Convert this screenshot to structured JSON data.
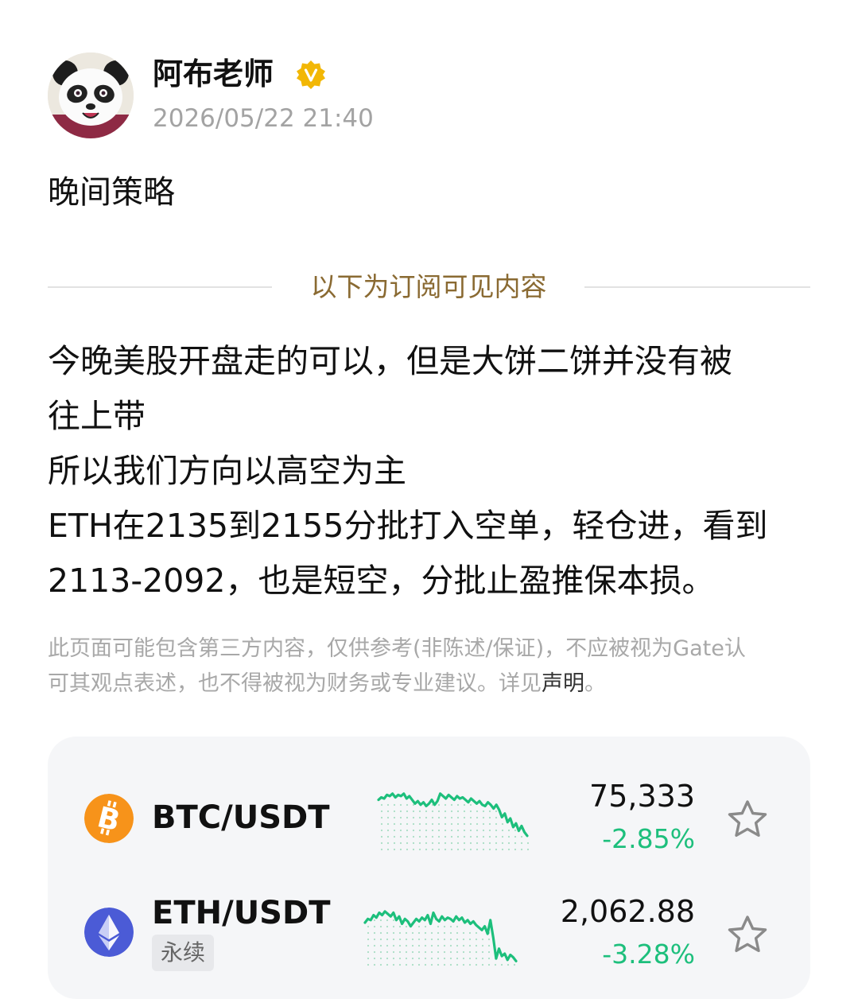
{
  "author": {
    "name": "阿布老师",
    "verified_icon": "verified-v-badge-icon",
    "timestamp": "2026/05/22 21:40"
  },
  "post": {
    "title": "晚间策略",
    "divider_label": "以下为订阅可见内容",
    "body_lines": [
      "今晚美股开盘走的可以，但是大饼二饼并没有被",
      "往上带",
      "所以我们方向以高空为主",
      "ETH在2135到2155分批打入空单，轻仓进，看到",
      "2113-2092，也是短空，分批止盈推保本损。"
    ]
  },
  "disclaimer": {
    "line1": "此页面可能包含第三方内容，仅供参考(非陈述/保证)，不应被视为Gate认",
    "line2_prefix": "可其观点表述，也不得被视为财务或专业建议。详见",
    "line2_link": "声明",
    "line2_suffix": "。"
  },
  "tickers": [
    {
      "pair": "BTC/USDT",
      "icon": "bitcoin-icon",
      "tag": "",
      "price": "75,333",
      "change": "-2.85%",
      "sparkline": [
        0.8,
        0.84,
        0.82,
        0.88,
        0.86,
        0.9,
        0.84,
        0.88,
        0.86,
        0.9,
        0.82,
        0.86,
        0.8,
        0.74,
        0.78,
        0.72,
        0.76,
        0.7,
        0.74,
        0.8,
        0.72,
        0.78,
        0.9,
        0.86,
        0.82,
        0.88,
        0.84,
        0.8,
        0.86,
        0.82,
        0.84,
        0.8,
        0.76,
        0.82,
        0.78,
        0.74,
        0.78,
        0.72,
        0.7,
        0.76,
        0.72,
        0.66,
        0.72,
        0.64,
        0.52,
        0.58,
        0.44,
        0.5,
        0.36,
        0.42,
        0.3,
        0.38,
        0.28,
        0.22
      ]
    },
    {
      "pair": "ETH/USDT",
      "icon": "ethereum-icon",
      "tag": "永续",
      "price": "2,062.88",
      "change": "-3.28%",
      "sparkline": [
        0.68,
        0.74,
        0.72,
        0.8,
        0.76,
        0.84,
        0.8,
        0.86,
        0.82,
        0.78,
        0.84,
        0.72,
        0.78,
        0.66,
        0.74,
        0.7,
        0.62,
        0.68,
        0.74,
        0.7,
        0.76,
        0.72,
        0.8,
        0.66,
        0.84,
        0.74,
        0.7,
        0.78,
        0.72,
        0.76,
        0.74,
        0.7,
        0.78,
        0.72,
        0.76,
        0.68,
        0.72,
        0.66,
        0.7,
        0.64,
        0.6,
        0.56,
        0.62,
        0.5,
        0.72,
        0.44,
        0.1,
        0.26,
        0.14,
        0.18,
        0.08,
        0.16,
        0.12,
        0.06
      ]
    }
  ],
  "colors": {
    "accent_gold": "#8a6a32",
    "positive_green": "#1dbf7c",
    "btc_orange": "#f7931a",
    "eth_blue": "#4b5bd6",
    "verified_gold": "#f2b705"
  }
}
